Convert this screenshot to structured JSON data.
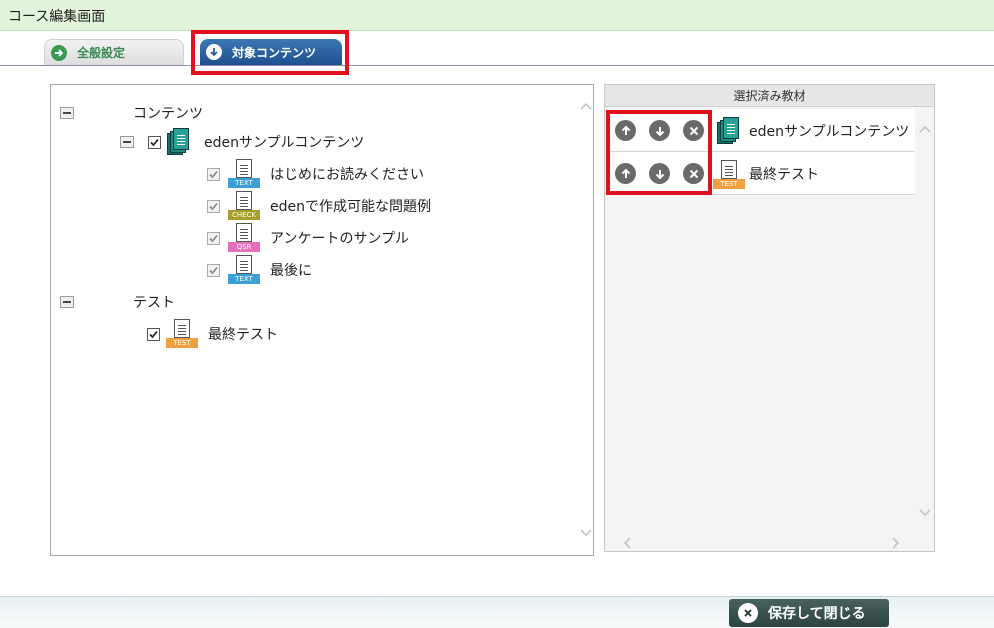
{
  "window": {
    "title": "コース編集画面"
  },
  "tabs": {
    "general": {
      "label": "全般設定",
      "icon": "arrow-right-circle-icon"
    },
    "content": {
      "label": "対象コンテンツ",
      "icon": "arrow-down-circle-icon"
    }
  },
  "tree": {
    "group_content": {
      "label": "コンテンツ",
      "package": {
        "label": "edenサンプルコンテンツ",
        "checked": true,
        "icon": "content-stack-icon"
      },
      "items": [
        {
          "label": "はじめにお読みください",
          "badge": "TEXT",
          "badge_color": "#3e9ed6",
          "checked": true
        },
        {
          "label": "edenで作成可能な問題例",
          "badge": "CHECK",
          "badge_color": "#a6a02a",
          "checked": true
        },
        {
          "label": "アンケートのサンプル",
          "badge": "QSR",
          "badge_color": "#e86fb9",
          "checked": true
        },
        {
          "label": "最後に",
          "badge": "TEXT",
          "badge_color": "#3e9ed6",
          "checked": true
        }
      ]
    },
    "group_test": {
      "label": "テスト",
      "items": [
        {
          "label": "最終テスト",
          "badge": "TEST",
          "badge_color": "#f0a040",
          "checked": true
        }
      ]
    }
  },
  "selected": {
    "header": "選択済み教材",
    "items": [
      {
        "label": "edenサンプルコンテンツ",
        "icon": "content-stack-icon"
      },
      {
        "label": "最終テスト",
        "badge": "TEST",
        "badge_color": "#f0a040",
        "icon": "test-doc-icon"
      }
    ]
  },
  "footer": {
    "save_close_label": "保存して閉じる"
  },
  "colors": {
    "highlight": "#e0111e",
    "titlebar": "#e2f4dc",
    "active_tab": "#2a5e9c"
  }
}
